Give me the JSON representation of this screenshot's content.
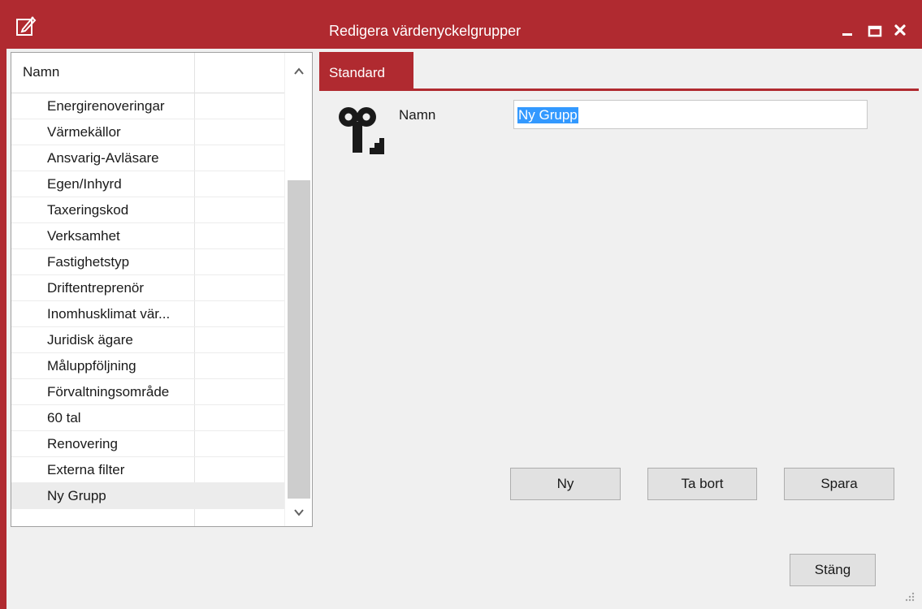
{
  "window": {
    "title": "Redigera värdenyckelgrupper",
    "accent_color": "#b02a30",
    "icon": "edit-window-icon",
    "controls": [
      "minimize-icon",
      "maximize-icon",
      "close-icon"
    ]
  },
  "list": {
    "column_header": "Namn",
    "items": [
      "Energirenoveringar",
      "Värmekällor",
      "Ansvarig-Avläsare",
      "Egen/Inhyrd",
      "Taxeringskod",
      "Verksamhet",
      "Fastighetstyp",
      "Driftentreprenör",
      "Inomhusklimat vär...",
      "Juridisk ägare",
      "Måluppföljning",
      "Förvaltningsområde",
      "60 tal",
      "Renovering",
      "Externa filter",
      "Ny Grupp"
    ],
    "selected_item": "Ny Grupp"
  },
  "tabs": [
    {
      "label": "Standard",
      "active": true
    }
  ],
  "form": {
    "icon": "key-group-icon",
    "name_label": "Namn",
    "name_value": "Ny Grupp"
  },
  "buttons": {
    "new": "Ny",
    "delete": "Ta bort",
    "save": "Spara",
    "close": "Stäng"
  }
}
